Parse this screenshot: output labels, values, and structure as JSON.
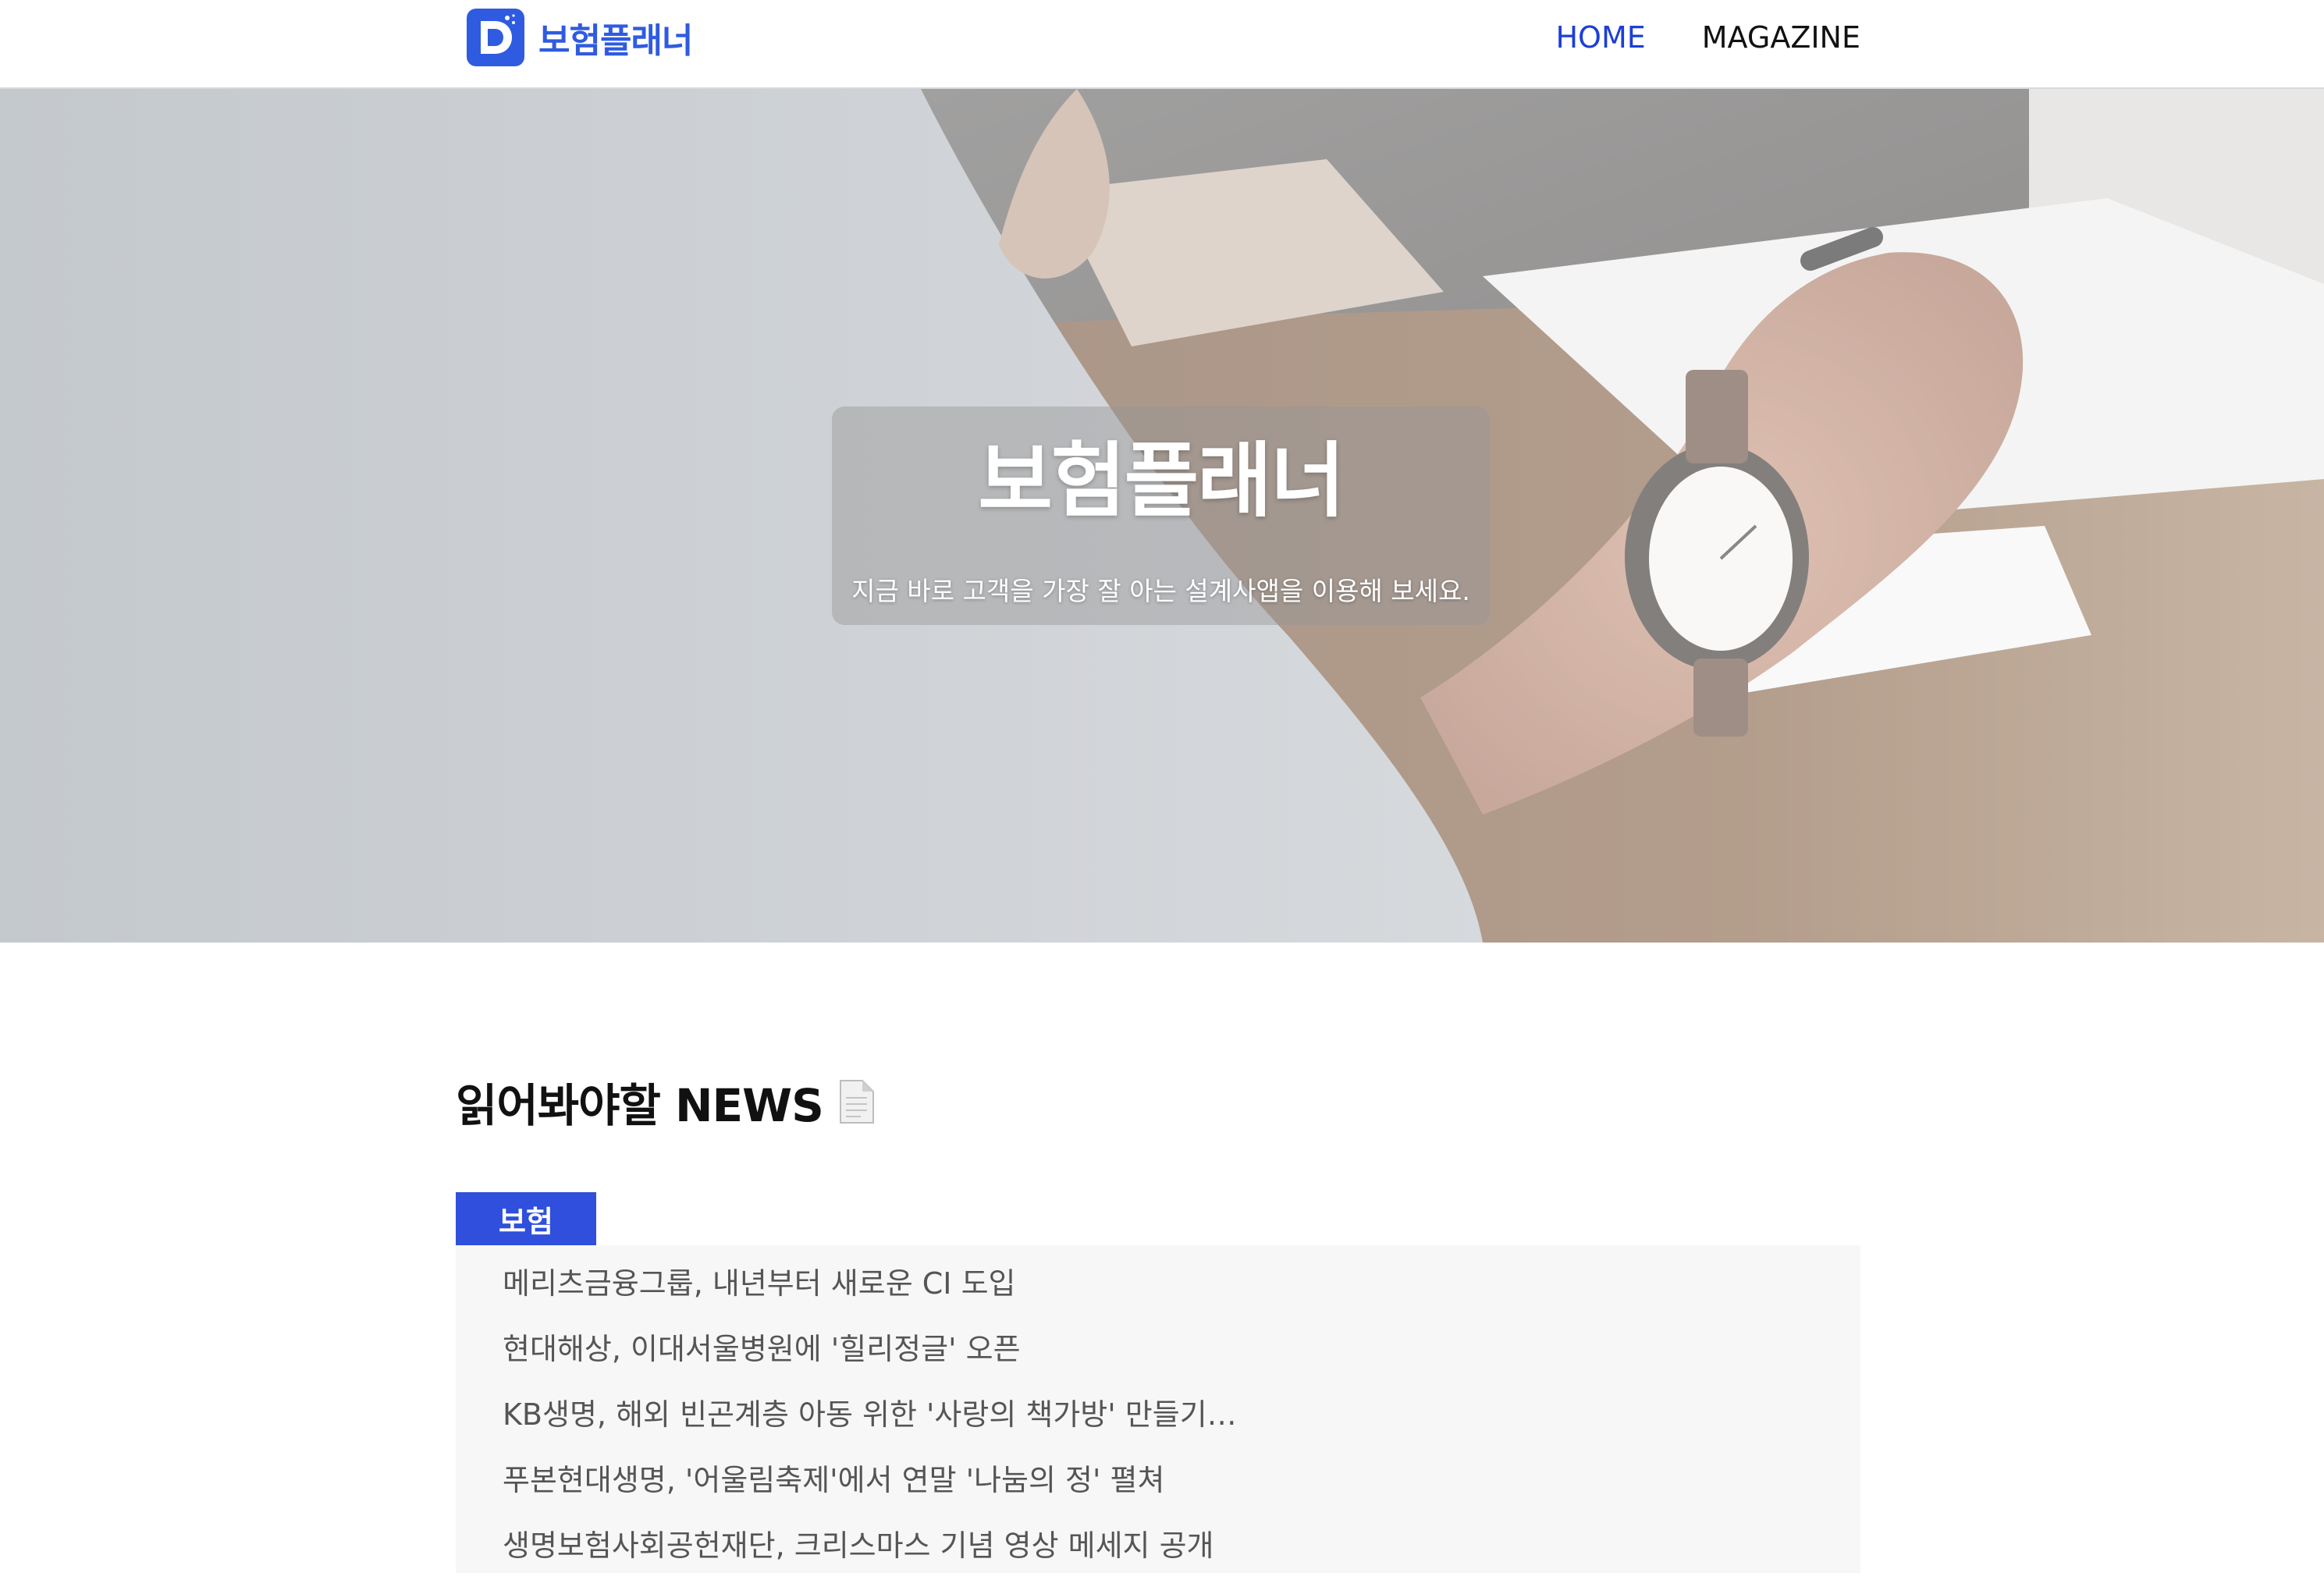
{
  "header": {
    "brand": "보험플래너",
    "nav": [
      {
        "label": "HOME",
        "active": true
      },
      {
        "label": "MAGAZINE",
        "active": false
      }
    ],
    "accent_color": "#1c3fd6"
  },
  "hero": {
    "title": "보험플래너",
    "subtitle": "지금 바로 고객을 가장 잘 아는 설계사앱을 이용해 보세요."
  },
  "news": {
    "heading": "읽어봐야할 NEWS",
    "heading_icon": "document-icon",
    "tab_label": "보험",
    "items": [
      "메리츠금융그룹, 내년부터 새로운 CI 도입",
      "현대해상, 이대서울병원에 '힐리정글' 오픈",
      "KB생명, 해외 빈곤계층 아동 위한 '사랑의 책가방' 만들기…",
      "푸본현대생명, '어울림축제'에서 연말 '나눔의 정' 펼쳐",
      "생명보험사회공헌재단, 크리스마스 기념 영상 메세지 공개"
    ]
  }
}
